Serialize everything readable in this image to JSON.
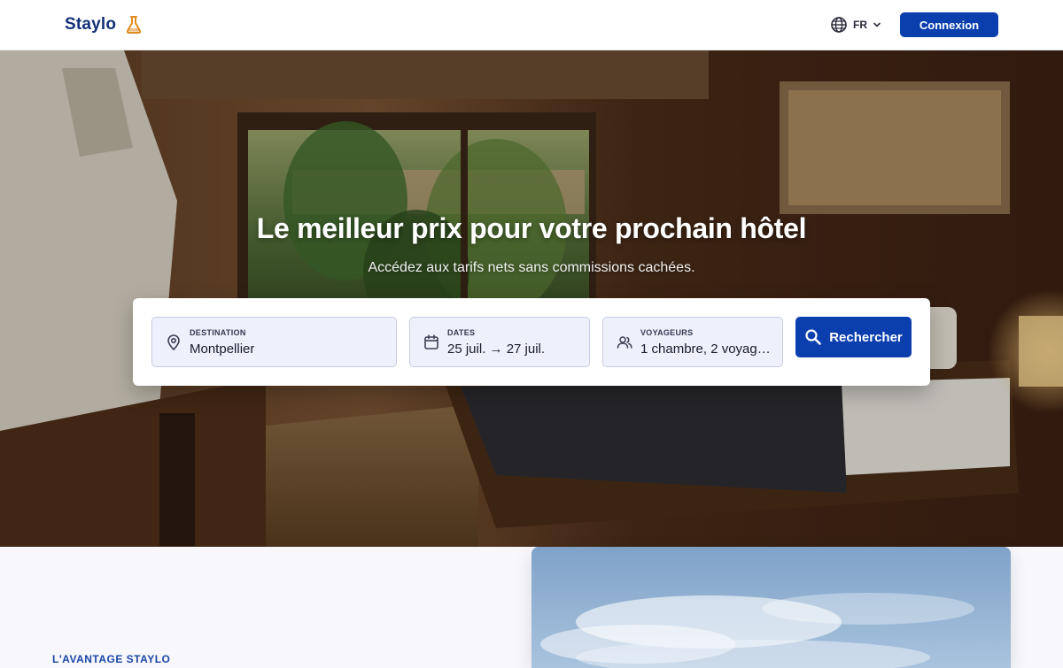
{
  "header": {
    "logo_text": "Staylo",
    "language": "FR",
    "login_label": "Connexion"
  },
  "hero": {
    "title": "Le meilleur prix pour votre prochain hôtel",
    "subtitle": "Accédez aux tarifs nets sans commissions cachées."
  },
  "search": {
    "destination": {
      "label": "DESTINATION",
      "value": "Montpellier",
      "icon": "location-pin-icon"
    },
    "dates": {
      "label": "DATES",
      "value": "25 juil. → 27 juil.",
      "icon": "calendar-icon"
    },
    "guests": {
      "label": "VOYAGEURS",
      "value": "1 chambre, 2 voyage…",
      "icon": "users-icon"
    },
    "button_label": "Rechercher"
  },
  "advantage": {
    "eyebrow": "L'AVANTAGE STAYLO"
  },
  "colors": {
    "brand": "#0b3fae",
    "logo": "#13307a",
    "flask": "#e08a1e",
    "field_bg": "#eef0fb"
  }
}
